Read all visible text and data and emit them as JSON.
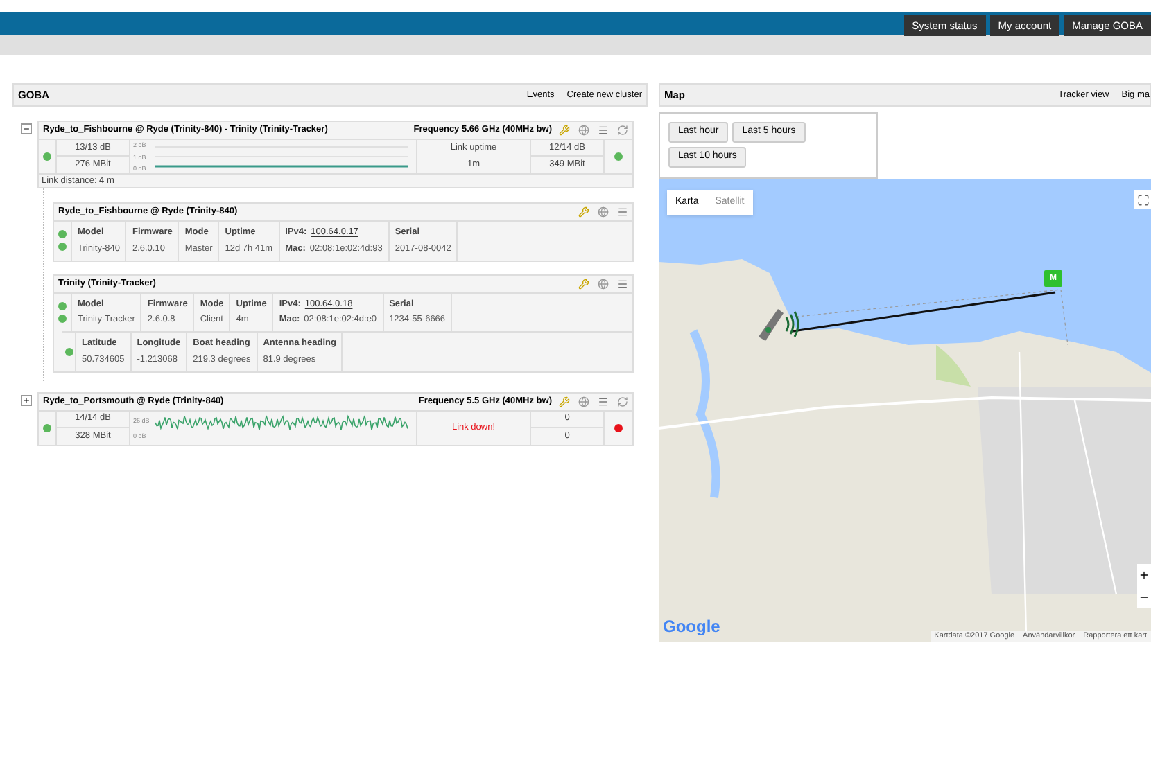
{
  "top_nav": {
    "buttons": [
      "System status",
      "My account",
      "Manage GOBA"
    ]
  },
  "goba_panel": {
    "title": "GOBA",
    "actions": [
      "Events",
      "Create new cluster"
    ],
    "links": [
      {
        "title": "Ryde_to_Fishbourne @ Ryde (Trinity-840) - Trinity (Trinity-Tracker)",
        "expanded": true,
        "frequency": "Frequency 5.66 GHz (40MHz bw)",
        "left_up": true,
        "left_snr": "13/13 dB",
        "left_rate": "276 MBit",
        "graph": {
          "kind": "flat",
          "axis_labels": [
            "2 dB",
            "1 dB",
            "0 dB"
          ]
        },
        "link_down": false,
        "middle_label": "Link uptime",
        "middle_value": "1m",
        "right_snr": "12/14 dB",
        "right_rate": "349 MBit",
        "right_up": true,
        "distance": "Link distance: 4 m",
        "devices": [
          {
            "title": "Ryde_to_Fishbourne @ Ryde (Trinity-840)",
            "status_ok": [
              true,
              true
            ],
            "columns": [
              {
                "label": "Model",
                "value": "Trinity-840"
              },
              {
                "label": "Firmware",
                "value": "2.6.0.10"
              },
              {
                "label": "Mode",
                "value": "Master"
              },
              {
                "label": "Uptime",
                "value": "12d 7h 41m"
              }
            ],
            "ipv4_label": "IPv4:",
            "ipv4": "100.64.0.17",
            "mac_label": "Mac:",
            "mac": "02:08:1e:02:4d:93",
            "serial_label": "Serial",
            "serial": "2017-08-0042"
          },
          {
            "title": "Trinity (Trinity-Tracker)",
            "status_ok": [
              true,
              true
            ],
            "columns": [
              {
                "label": "Model",
                "value": "Trinity-Tracker"
              },
              {
                "label": "Firmware",
                "value": "2.6.0.8"
              },
              {
                "label": "Mode",
                "value": "Client"
              },
              {
                "label": "Uptime",
                "value": "4m"
              }
            ],
            "ipv4_label": "IPv4:",
            "ipv4": "100.64.0.18",
            "mac_label": "Mac:",
            "mac": "02:08:1e:02:4d:e0",
            "serial_label": "Serial",
            "serial": "1234-55-6666",
            "gps_ok": true,
            "gps": [
              {
                "label": "Latitude",
                "value": "50.734605"
              },
              {
                "label": "Longitude",
                "value": "-1.213068"
              },
              {
                "label": "Boat heading",
                "value": "219.3 degrees"
              },
              {
                "label": "Antenna heading",
                "value": "81.9 degrees"
              }
            ]
          }
        ]
      },
      {
        "title": "Ryde_to_Portsmouth @ Ryde (Trinity-840)",
        "expanded": false,
        "frequency": "Frequency 5.5 GHz (40MHz bw)",
        "left_up": true,
        "left_snr": "14/14 dB",
        "left_rate": "328 MBit",
        "graph": {
          "kind": "noisy",
          "axis_labels": [
            "26 dB",
            "0 dB"
          ]
        },
        "link_down": true,
        "middle_value": "Link down!",
        "right_snr": "0",
        "right_rate": "0",
        "right_up": false
      }
    ]
  },
  "map_panel": {
    "title": "Map",
    "actions": [
      "Tracker view",
      "Big ma"
    ],
    "time_buttons": [
      "Last hour",
      "Last 5 hours",
      "Last 10 hours"
    ],
    "map_types": [
      {
        "label": "Karta",
        "selected": true
      },
      {
        "label": "Satellit",
        "selected": false
      }
    ],
    "marker_label": "M",
    "logo": "Google",
    "attribution": [
      "Kartdata ©2017 Google",
      "Användarvillkor",
      "Rapportera ett kart"
    ]
  }
}
